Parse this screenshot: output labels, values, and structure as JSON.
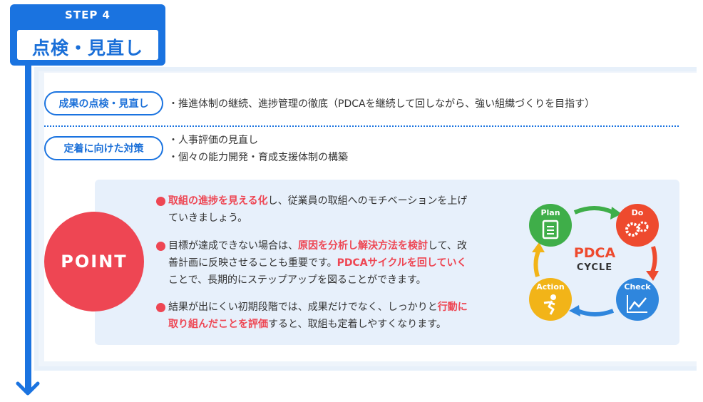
{
  "step": {
    "label": "STEP 4",
    "title": "点検・見直し"
  },
  "rows": [
    {
      "pill": "成果の点検・見直し",
      "items": [
        "・推進体制の継続、進捗管理の徹底（PDCAを継続して回しながら、強い組織づくりを目指す）"
      ]
    },
    {
      "pill": "定着に向けた対策",
      "items": [
        "・人事評価の見直し",
        "・個々の能力開発・育成支援体制の構築"
      ]
    }
  ],
  "point": {
    "badge": "POINT",
    "p1": {
      "red": "取組の進捗を見える化",
      "a": "し、従業員の取組へのモチベーションを上げ",
      "b": "ていきましょう。"
    },
    "p2": {
      "a": "目標が達成できない場合は、",
      "red1": "原因を分析し解決方法を検討",
      "b": "して、改",
      "c": "善計画に反映させることも重要です。",
      "red2": "PDCAサイクルを回していく",
      "d": "ことで、長期的にステップアップを図ることができます。"
    },
    "p3": {
      "a": "結果が出にくい初期段階では、成果だけでなく、しっかりと",
      "red1": "行動に",
      "red2": "取り組んだことを評価",
      "b": "すると、取組も定着しやすくなります。"
    }
  },
  "pdca": {
    "plan": "Plan",
    "do": "Do",
    "check": "Check",
    "action": "Action",
    "center1": "PDCA",
    "center2": "CYCLE",
    "colors": {
      "plan": "#3fae49",
      "do": "#ee4a2e",
      "check": "#2f86dd",
      "action": "#f2b418"
    }
  }
}
